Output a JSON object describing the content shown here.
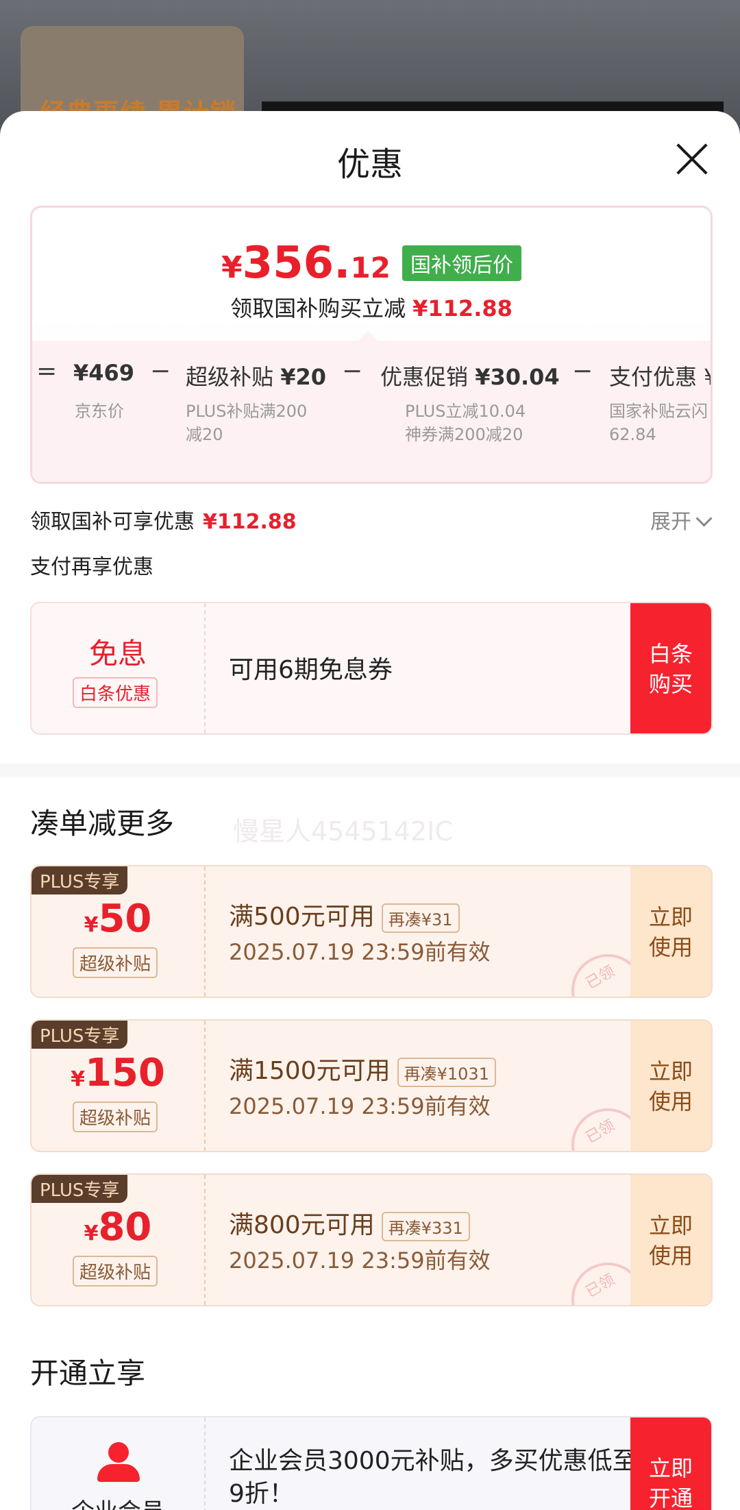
{
  "background": {
    "promo_text": "经典再续 累计销量"
  },
  "sheet": {
    "title": "优惠"
  },
  "price_card": {
    "currency": "¥",
    "price_int": "356.",
    "price_dec": "12",
    "badge": "国补领后价",
    "subtitle": "领取国补购买立减",
    "subtitle_amount": "¥112.88",
    "breakdown": [
      {
        "symbol": "=",
        "label": "",
        "value": "¥469",
        "desc": [
          "京东价"
        ]
      },
      {
        "symbol": "−",
        "label": "超级补贴 ",
        "value": "¥20",
        "desc": [
          "PLUS补贴满200",
          "减20"
        ]
      },
      {
        "symbol": "−",
        "label": "优惠促销 ",
        "value": "¥30.04",
        "desc": [
          "PLUS立减10.04",
          "神券满200减20"
        ]
      },
      {
        "symbol": "−",
        "label": "支付优惠 ¥",
        "value": "",
        "desc": [
          "国家补贴云闪",
          "62.84"
        ]
      }
    ]
  },
  "gov_row": {
    "label": "领取国补可享优惠",
    "amount": "¥112.88",
    "expand": "展开"
  },
  "pay_row": {
    "label": "支付再享优惠"
  },
  "baitiao": {
    "main": "免息",
    "tag": "白条优惠",
    "text": "可用6期免息券",
    "button": "白条\n购买",
    "watermark": "慢星人4545142IC"
  },
  "coupons_section": {
    "title": "凑单减更多",
    "coupons": [
      {
        "badge": "PLUS专享",
        "sym": "¥",
        "amount": "50",
        "tag": "超级补贴",
        "condition": "满500元可用",
        "chip": "再凑¥31",
        "date": "2025.07.19 23:59前有效",
        "button": "立即\n使用",
        "stamp": "已领"
      },
      {
        "badge": "PLUS专享",
        "sym": "¥",
        "amount": "150",
        "tag": "超级补贴",
        "condition": "满1500元可用",
        "chip": "再凑¥1031",
        "date": "2025.07.19 23:59前有效",
        "button": "立即\n使用",
        "stamp": "已领"
      },
      {
        "badge": "PLUS专享",
        "sym": "¥",
        "amount": "80",
        "tag": "超级补贴",
        "condition": "满800元可用",
        "chip": "再凑¥331",
        "date": "2025.07.19 23:59前有效",
        "button": "立即\n使用",
        "stamp": "已领"
      }
    ]
  },
  "member_section": {
    "title": "开通立享",
    "name": "企业会员",
    "text": "企业会员3000元补贴，多买优惠低至9折！",
    "button": "立即\n开通"
  }
}
